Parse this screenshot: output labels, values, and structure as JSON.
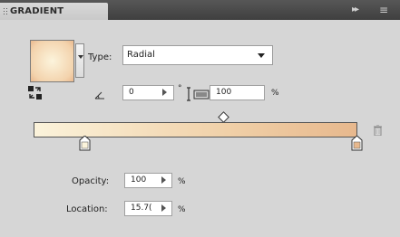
{
  "panel": {
    "title": "GRADIENT",
    "collapse_glyph": "▸▸",
    "menu_glyph": "≡"
  },
  "gradient": {
    "type_label": "Type:",
    "type_value": "Radial",
    "angle_value": "0",
    "degree_symbol": "°",
    "aspect_value": "100",
    "aspect_unit": "%"
  },
  "stop": {
    "opacity_label": "Opacity:",
    "opacity_value": "100",
    "opacity_unit": "%",
    "location_label": "Location:",
    "location_value": "15.7(",
    "location_unit": "%"
  },
  "icons": {
    "swatch": "gradient-swatch",
    "reverse": "reverse-gradient-icon",
    "angle": "angle-icon",
    "aspect": "aspect-ratio-icon",
    "trash": "delete-stop-icon"
  },
  "colors": {
    "start": "#fbf3db",
    "end": "#e7b88d"
  }
}
